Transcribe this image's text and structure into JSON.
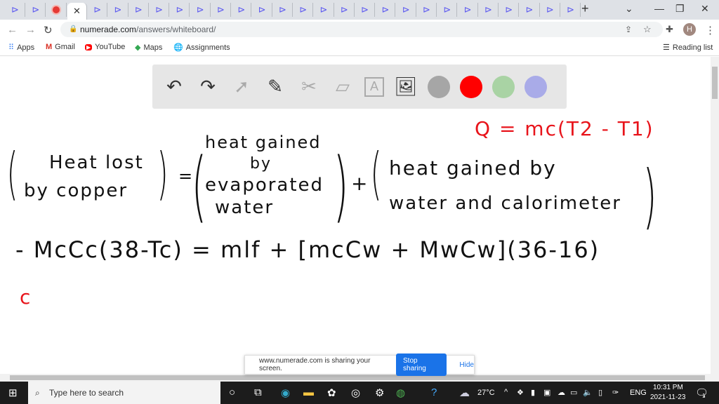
{
  "browser": {
    "url_host": "numerade.com",
    "url_path": "/answers/whiteboard/",
    "tab_count": 24,
    "new_tab": "+",
    "profile": "H",
    "bookmarks": [
      {
        "label": "Apps"
      },
      {
        "label": "Gmail"
      },
      {
        "label": "YouTube"
      },
      {
        "label": "Maps"
      },
      {
        "label": "Assignments"
      }
    ],
    "reading_list": "Reading list"
  },
  "toolbar": {
    "tools": [
      "undo-icon",
      "redo-icon",
      "pointer-icon",
      "pen-icon",
      "tools-icon",
      "eraser-icon",
      "text-icon",
      "image-icon"
    ],
    "colors": [
      "#a6a6a6",
      "#ff0000",
      "#a9d3a4",
      "#a9abe8"
    ]
  },
  "whiteboard": {
    "formula": "Q = mc(T2 - T1)",
    "lhs": [
      "Heat lost",
      "by copper"
    ],
    "mid": [
      "heat gained",
      "by",
      "evaporated",
      "water"
    ],
    "plus": "+",
    "eq": "=",
    "rhs": [
      "heat gained by",
      "water and calorimeter"
    ],
    "equation": "- McCc(38-Tc) = mlf + [mcCw + MwCw](36-16)",
    "mark": "c"
  },
  "share": {
    "text": "www.numerade.com is sharing your screen.",
    "stop": "Stop sharing",
    "hide": "Hide"
  },
  "taskbar": {
    "search_placeholder": "Type here to search",
    "weather": "27°C",
    "lang": "ENG",
    "time": "10:31 PM",
    "date": "2021-11-23",
    "notifications": "1"
  }
}
